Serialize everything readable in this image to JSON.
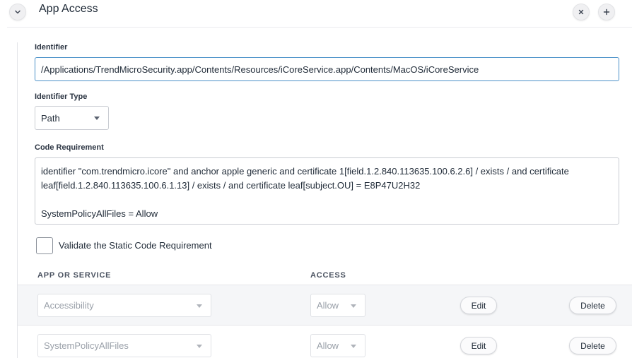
{
  "section": {
    "title": "App Access",
    "collapse_icon": "chevron-down-icon",
    "remove_icon": "close-icon",
    "add_icon": "plus-icon"
  },
  "identifier": {
    "label": "Identifier",
    "value": "/Applications/TrendMicroSecurity.app/Contents/Resources/iCoreService.app/Contents/MacOS/iCoreService"
  },
  "identifier_type": {
    "label": "Identifier Type",
    "value": "Path"
  },
  "code_requirement": {
    "label": "Code Requirement",
    "value": "identifier \"com.trendmicro.icore\" and anchor apple generic and certificate 1[field.1.2.840.113635.100.6.2.6] / exists / and certificate leaf[field.1.2.840.113635.100.6.1.13] / exists / and certificate leaf[subject.OU] = E8P47U2H32\n\nSystemPolicyAllFiles = Allow"
  },
  "validate": {
    "label": "Validate the Static Code Requirement",
    "checked": false
  },
  "table": {
    "headers": {
      "service": "APP OR SERVICE",
      "access": "ACCESS"
    },
    "rows": [
      {
        "service": "Accessibility",
        "access": "Allow",
        "edit": "Edit",
        "delete": "Delete"
      },
      {
        "service": "SystemPolicyAllFiles",
        "access": "Allow",
        "edit": "Edit",
        "delete": "Delete"
      }
    ]
  }
}
